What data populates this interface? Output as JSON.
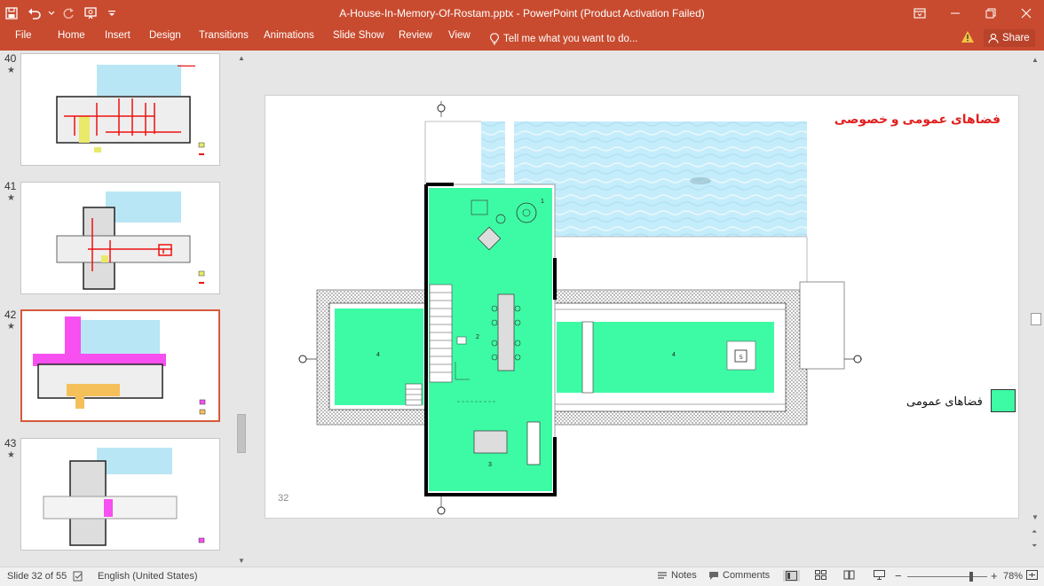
{
  "titlebar": {
    "title": "A-House-In-Memory-Of-Rostam.pptx - PowerPoint (Product Activation Failed)",
    "bg_color": "#c84b2f"
  },
  "quick_access": {
    "icons": [
      "save-icon",
      "undo-icon",
      "undo-dropdown-icon",
      "redo-icon",
      "slideshow-from-beginning-icon",
      "customize-qat-icon"
    ]
  },
  "window_controls": {
    "icons": [
      "ribbon-display-options-icon",
      "minimize-icon",
      "restore-icon",
      "close-icon"
    ]
  },
  "ribbon": {
    "tabs": [
      "File",
      "Home",
      "Insert",
      "Design",
      "Transitions",
      "Animations",
      "Slide Show",
      "Review",
      "View"
    ],
    "tell_me": "Tell me what you want to do...",
    "share": "Share"
  },
  "thumbnails": [
    {
      "number": "40",
      "star": "★"
    },
    {
      "number": "41",
      "star": "★"
    },
    {
      "number": "42",
      "star": "★"
    },
    {
      "number": "43",
      "star": "★"
    }
  ],
  "slide": {
    "title": "فضاهای عمومی و خصوصی",
    "page_number": "32",
    "legend_label": "فضاهای عمومی",
    "legend_color": "#3dfba5",
    "plan_labels": [
      "1",
      "2",
      "3",
      "4",
      "4",
      "5"
    ]
  },
  "statusbar": {
    "slide_info": "Slide 32 of 55",
    "language": "English (United States)",
    "notes": "Notes",
    "comments": "Comments",
    "zoom": "78%",
    "zoom_minus": "−",
    "zoom_plus": "+"
  }
}
